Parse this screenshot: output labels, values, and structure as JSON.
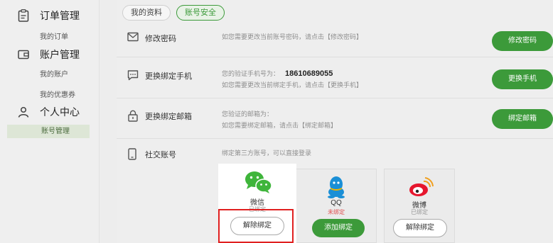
{
  "sidebar": {
    "groups": [
      {
        "title": "订单管理",
        "icon": "clipboard-icon",
        "items": [
          "我的订单"
        ]
      },
      {
        "title": "账户管理",
        "icon": "wallet-icon",
        "items": [
          "我的账户",
          "我的优惠券"
        ]
      },
      {
        "title": "个人中心",
        "icon": "user-icon",
        "items": [
          "账号管理"
        ]
      }
    ]
  },
  "tabs": [
    "我的资料",
    "账号安全"
  ],
  "security": {
    "password": {
      "title": "修改密码",
      "desc": "如您需要更改当前账号密码，请点击【修改密码】",
      "button": "修改密码"
    },
    "phone": {
      "title": "更换绑定手机",
      "label": "您的验证手机号为：",
      "number": "18610689055",
      "desc": "如您需要更改当前绑定手机，请点击【更换手机】",
      "button": "更换手机"
    },
    "email": {
      "title": "更换绑定邮箱",
      "label": "您验证的邮箱为：",
      "desc": "如您需要绑定邮箱，请点击【绑定邮箱】",
      "button": "绑定邮箱"
    },
    "social": {
      "title": "社交账号",
      "desc": "绑定第三方账号，可以直接登录",
      "cards": [
        {
          "name": "微信",
          "status": "已绑定",
          "button": "解除绑定",
          "icon": "wechat-icon"
        },
        {
          "name": "QQ",
          "status": "未绑定",
          "button": "添加绑定",
          "icon": "qq-icon"
        },
        {
          "name": "微博",
          "status": "已绑定",
          "button": "解除绑定",
          "icon": "weibo-icon"
        }
      ]
    }
  },
  "colors": {
    "accent": "#3c9a3a",
    "warning": "#e05050",
    "highlight": "#e02020"
  }
}
